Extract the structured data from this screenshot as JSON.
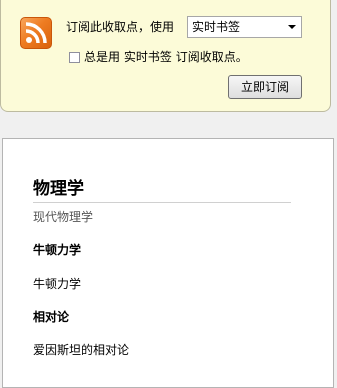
{
  "subscribe": {
    "label": "订阅此收取点，使用",
    "reader_selected": "实时书签",
    "always_prefix": "总是用",
    "always_reader": "实时书签",
    "always_suffix": "订阅收取点。",
    "button_label": "立即订阅",
    "checkbox_checked": false
  },
  "feed": {
    "title": "物理学",
    "subtitle": "现代物理学",
    "entries": [
      {
        "title": "牛顿力学",
        "body": "牛顿力学"
      },
      {
        "title": "相对论",
        "body": "爱因斯坦的相对论"
      }
    ]
  },
  "icons": {
    "feed": "rss-feed-icon",
    "dropdown": "chevron-down-icon"
  },
  "colors": {
    "panel_background": "#fcfbd8",
    "feed_icon": "#ee7c22"
  }
}
